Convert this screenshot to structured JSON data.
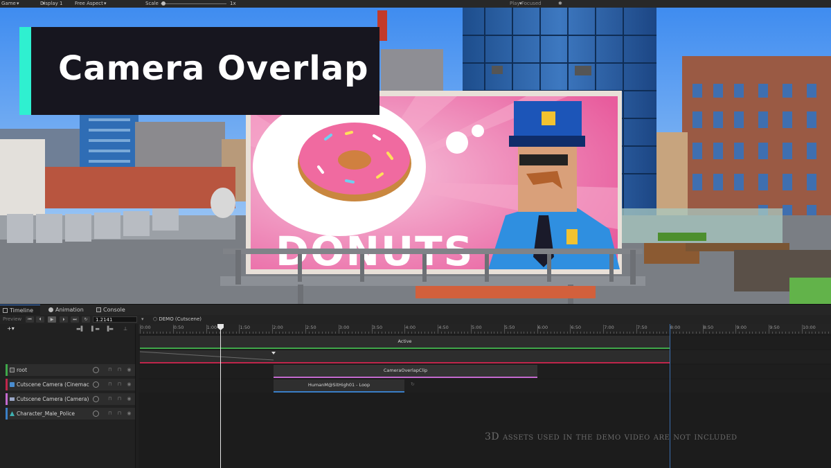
{
  "game_toolbar": {
    "view": "Game",
    "display": "Display 1",
    "aspect": "Free Aspect",
    "scale_label": "Scale",
    "scale_value": "1x",
    "play_mode": "Play Focused"
  },
  "overlay": {
    "title": "Camera Overlap"
  },
  "scene": {
    "billboard_text": "DONUTS"
  },
  "tabs": [
    {
      "label": "Timeline",
      "icon": "timeline-icon"
    },
    {
      "label": "Animation",
      "icon": "animation-icon"
    },
    {
      "label": "Console",
      "icon": "console-icon"
    }
  ],
  "controls": {
    "preview": "Preview",
    "time": "1.2141",
    "timeline_asset": "DEMO (Cutscene)"
  },
  "ruler": [
    "0:00",
    "0:50",
    "1:00",
    "1:50",
    "2:00",
    "2:50",
    "3:00",
    "3:50",
    "4:00",
    "4:50",
    "5:00",
    "5:50",
    "6:00",
    "6:50",
    "7:00",
    "7:50",
    "8:00",
    "8:50",
    "9:00",
    "9:50",
    "10:00"
  ],
  "tracks": [
    {
      "label": "root",
      "color": "#3fa84a",
      "icon": "check-icon"
    },
    {
      "label": "Cutscene Camera (Cinemac",
      "color": "#c0264b",
      "icon": "cinemachine-icon"
    },
    {
      "label": "Cutscene Camera (Camera)",
      "color": "#c46ad0",
      "icon": "camera-icon"
    },
    {
      "label": "Character_Male_Police",
      "color": "#3a7fc7",
      "icon": "animator-icon"
    }
  ],
  "clips": {
    "active": "Active",
    "overlap": "CameraOverlapClip",
    "animation": "HumanM@SitHigh01 - Loop"
  },
  "disclaimer": "3D assets used in the demo video are not included"
}
